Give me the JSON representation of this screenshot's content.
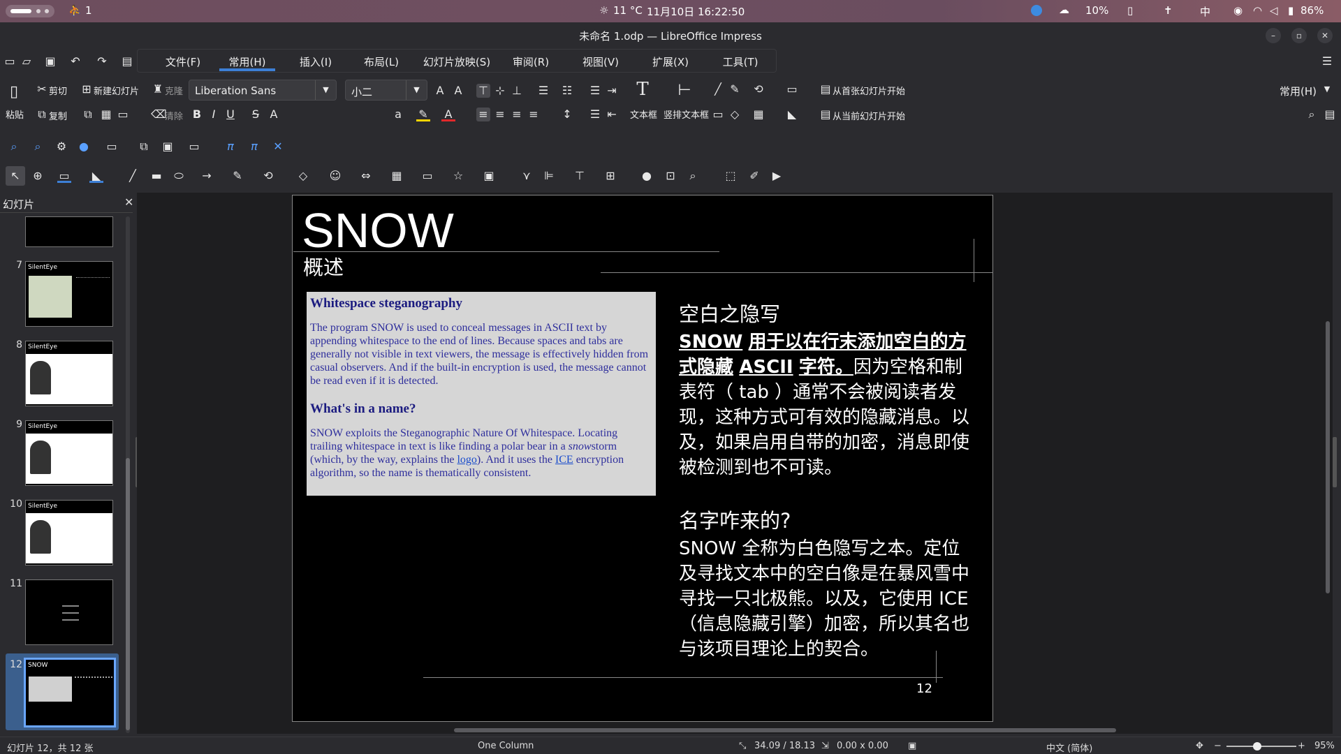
{
  "topbar": {
    "workspace": "1",
    "weather": "11 °C",
    "datetime": "11月10日  16:22:50",
    "rain": "10%",
    "input_method": "中",
    "battery": "86%"
  },
  "window": {
    "title": "未命名 1.odp — LibreOffice Impress"
  },
  "menu_tabs": [
    {
      "label": "文件(F)"
    },
    {
      "label": "常用(H)"
    },
    {
      "label": "插入(I)"
    },
    {
      "label": "布局(L)"
    },
    {
      "label": "幻灯片放映(S)"
    },
    {
      "label": "审阅(R)"
    },
    {
      "label": "视图(V)"
    },
    {
      "label": "扩展(X)"
    },
    {
      "label": "工具(T)"
    }
  ],
  "ribbon": {
    "paste": "粘贴",
    "cut": "剪切",
    "copy": "复制",
    "new_slide": "新建幻灯片",
    "clone": "克隆",
    "clear": "清除",
    "font_name": "Liberation Sans",
    "font_size": "小二",
    "textbox": "文本框",
    "vertical_textbox": "竖排文本框",
    "start_first": "从首张幻灯片开始",
    "start_current": "从当前幻灯片开始",
    "tab_selector": "常用(H)"
  },
  "sidebar": {
    "title": "幻灯片",
    "slides": [
      {
        "num": "7",
        "title": "SilentEye"
      },
      {
        "num": "8",
        "title": "SilentEye"
      },
      {
        "num": "9",
        "title": "SilentEye"
      },
      {
        "num": "10",
        "title": "SilentEye"
      },
      {
        "num": "11",
        "title": ""
      },
      {
        "num": "12",
        "title": "SNOW"
      }
    ]
  },
  "slide": {
    "title": "SNOW",
    "subtitle": "概述",
    "web": {
      "h1": "Whitespace steganography",
      "p1": "The program SNOW is used to conceal messages in ASCII text by appending whitespace to the end of lines. Because spaces and tabs are generally not visible in text viewers, the message is effectively hidden from casual observers. And if the built-in encryption is used, the message cannot be read even if it is detected.",
      "h2": "What's in a name?",
      "p2a": "SNOW exploits the Steganographic Nature Of Whitespace. Locating trailing whitespace in text is like finding a polar bear in a ",
      "p2_em": "snow",
      "p2b": "storm (which, by the way, explains the ",
      "p2_logo": "logo",
      "p2c": "). And it uses the ",
      "p2_ice": "ICE",
      "p2d": " encryption algorithm, so the name is thematically consistent."
    },
    "right": {
      "h1": "空白之隐写",
      "u1": "SNOW",
      "u2": "用于以在行末添加空白的方式隐藏",
      "u3": "ASCII",
      "u4": "字符。",
      "t1": "因为空格和制表符（ tab ）通常不会被阅读者发现，这种方式可有效的隐藏消息。以及，如果启用自带的加密，消息即使被检测到也不可读。",
      "h2": "名字咋来的?",
      "t2": "SNOW 全称为白色隐写之本。定位及寻找文本中的空白像是在暴风雪中寻找一只北极熊。以及，它使用 ICE （信息隐藏引擎）加密，所以其名也与该项目理论上的契合。"
    },
    "page_number": "12"
  },
  "status": {
    "slide_info": "幻灯片 12，共 12 张",
    "layout": "One Column",
    "position": "34.09 / 18.13",
    "size": "0.00 x 0.00",
    "language": "中文 (简体)",
    "zoom": "95%"
  }
}
